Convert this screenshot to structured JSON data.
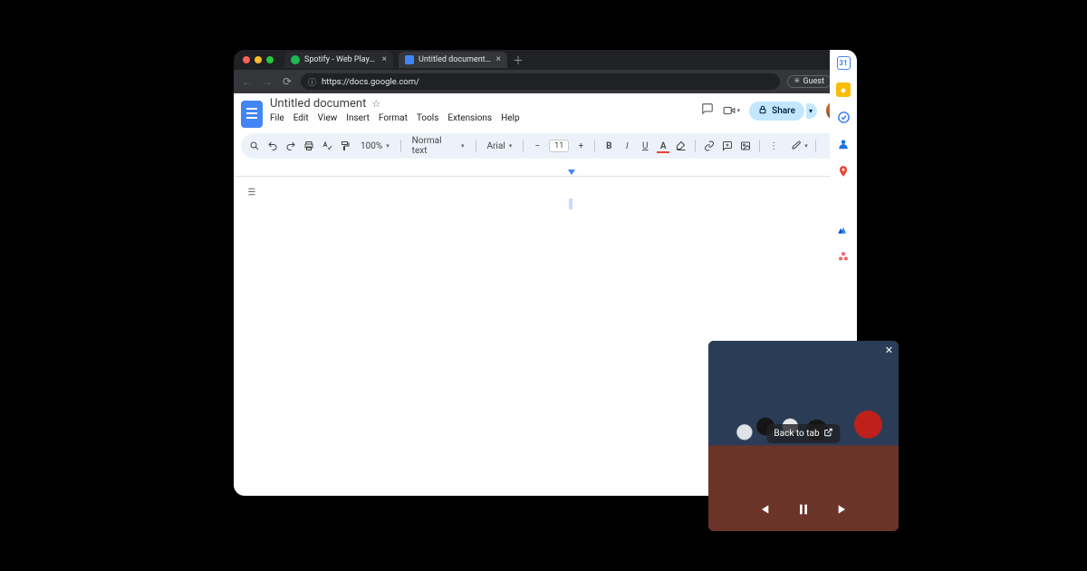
{
  "browser": {
    "tabs": [
      {
        "title": "Spotify - Web Player: Music f",
        "active": false,
        "icon_color": "#1db954"
      },
      {
        "title": "Untitled document - Google D",
        "active": true,
        "icon_color": "#4285f4"
      }
    ],
    "url": "https://docs.google.com/",
    "guest_label": "Guest"
  },
  "docs": {
    "title": "Untitled document",
    "menus": [
      "File",
      "Edit",
      "View",
      "Insert",
      "Format",
      "Tools",
      "Extensions",
      "Help"
    ],
    "share_label": "Share",
    "zoom": "100%",
    "style_name": "Normal text",
    "font_name": "Arial",
    "font_size": "11"
  },
  "pip": {
    "back_label": "Back to tab"
  }
}
